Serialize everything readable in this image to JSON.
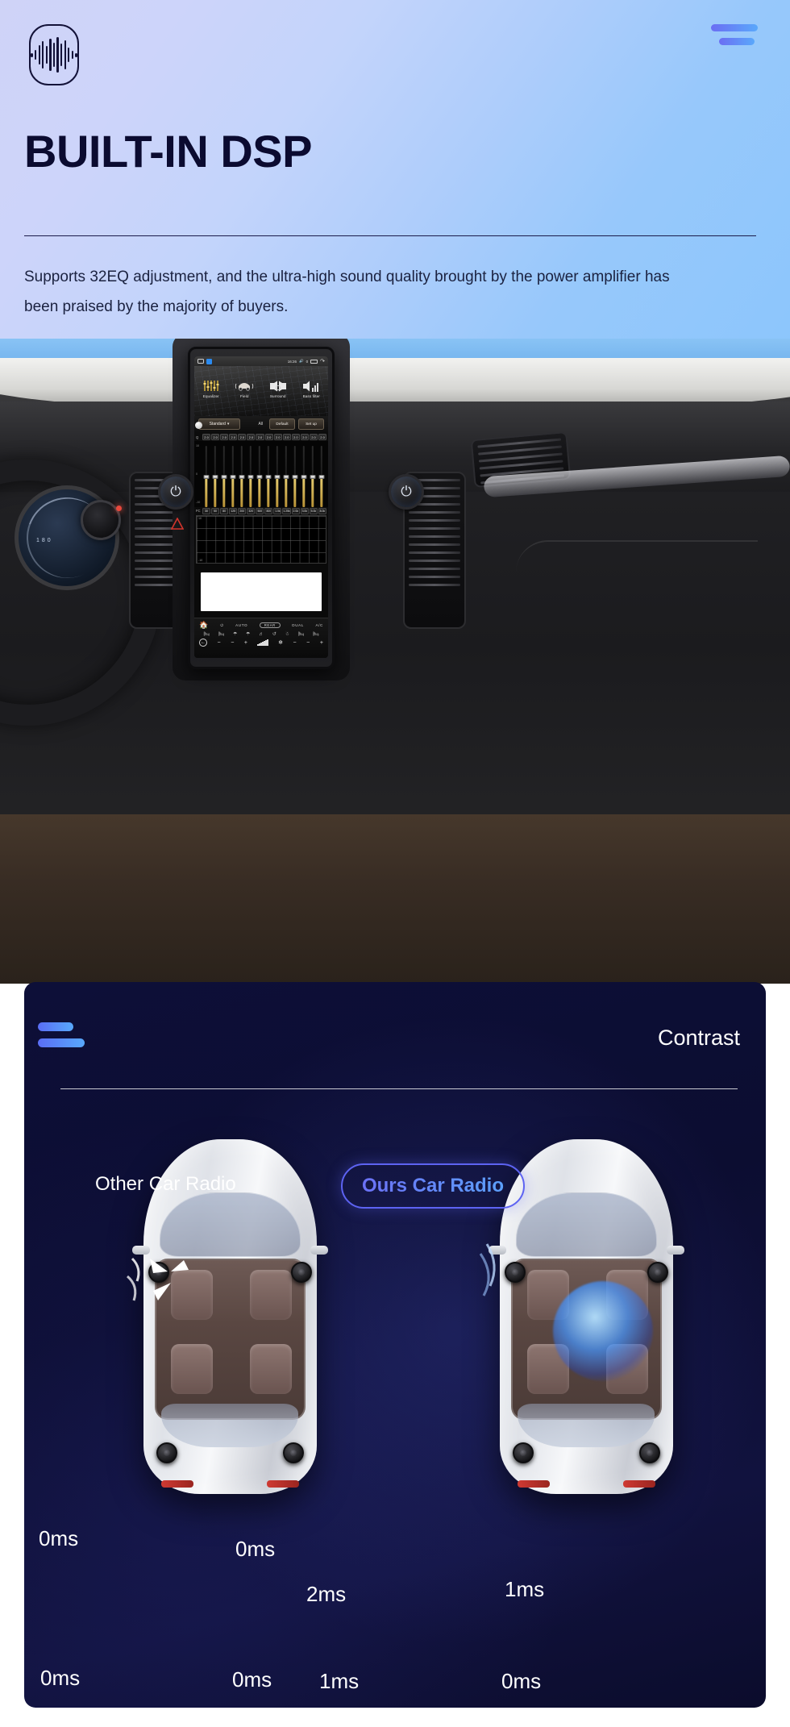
{
  "hero": {
    "icon_name": "audio-waveform-icon",
    "menu_icon": "hamburger-menu-icon",
    "title": "BUILT-IN DSP",
    "subtitle": "Supports 32EQ adjustment, and the ultra-high sound quality brought by the power amplifier has been praised by the majority of buyers.",
    "gradient_from": "#cfd3f7",
    "gradient_to": "#8cc6fc",
    "title_color": "#0b0b30",
    "accent_from": "#6b6ef3",
    "accent_to": "#5aa8fb"
  },
  "head_unit": {
    "status": {
      "time": "16:26",
      "volume_icon": "volume-icon",
      "battery_icon": "battery-icon",
      "back_icon": "back-arrow-icon",
      "car_icon": "car-icon",
      "app_icon": "app-icon",
      "signal": "0"
    },
    "tabs": [
      {
        "label": "Equalizer",
        "icon": "equalizer-sliders-icon",
        "active": true
      },
      {
        "label": "Field",
        "icon": "sound-field-car-icon",
        "active": false
      },
      {
        "label": "Surround",
        "icon": "surround-sound-icon",
        "active": false
      },
      {
        "label": "Bass filter",
        "icon": "bass-filter-icon",
        "active": false
      }
    ],
    "controls": {
      "preset": "Standard",
      "preset_caret": "⌄",
      "all_label": "All",
      "default_label": "Default",
      "setup_label": "Set up"
    },
    "eq": {
      "q_label": "Q",
      "fc_label": "FC",
      "axis_top": "10",
      "axis_zero": "0",
      "axis_bottom": "-10",
      "graph_axis_top": "10",
      "graph_axis_bottom": "-10",
      "q_values": [
        "2.0",
        "2.0",
        "2.0",
        "2.0",
        "2.0",
        "2.0",
        "2.0",
        "2.0",
        "2.0",
        "2.0",
        "2.0",
        "2.0",
        "2.0",
        "2.0"
      ],
      "frequencies": [
        "30",
        "50",
        "80",
        "125",
        "200",
        "320",
        "500",
        "800",
        "1.0k",
        "1.25k",
        "2.0k",
        "3.0k",
        "5.0k",
        "8.0k"
      ],
      "gains": [
        0,
        0,
        0,
        0,
        0,
        0,
        0,
        0,
        0,
        0,
        0,
        0,
        0,
        0
      ],
      "bar_color": "#cdb055"
    },
    "climate": {
      "home_icon": "home-icon",
      "power_icon": "power-icon",
      "auto_label": "AUTO",
      "rear_label": "REAR",
      "dual_label": "DUAL",
      "ac_label": "A/C",
      "back_icon": "back-arrow-circle-icon",
      "minus_left": "−",
      "minus_left2": "−",
      "plus_left": "+",
      "fan_icon": "fan-icon",
      "minus_right": "−",
      "minus_right2": "−",
      "plus_right": "+",
      "seat_heat_icons": [
        "seat-heat-left-icon",
        "seat-heat-right-icon",
        "defrost-front-icon",
        "defrost-rear-icon",
        "airflow-face-icon",
        "airflow-feet-icon",
        "recirculate-icon",
        "seat-vent-left-icon",
        "seat-vent-right-icon"
      ]
    }
  },
  "contrast": {
    "menu_icon": "hamburger-menu-icon",
    "title": "Contrast",
    "background": "#0d0f38",
    "left_car": {
      "name": "other-car-radio",
      "label": "Other Car Radio",
      "delays": [
        {
          "position": "front-left",
          "value": "0ms"
        },
        {
          "position": "front-right",
          "value": "0ms"
        },
        {
          "position": "rear-left",
          "value": "0ms"
        },
        {
          "position": "rear-right",
          "value": "0ms"
        }
      ]
    },
    "right_car": {
      "name": "ours-car-radio",
      "label": "Ours Car Radio",
      "delays": [
        {
          "position": "front-left",
          "value": "2ms"
        },
        {
          "position": "front-right",
          "value": "1ms"
        },
        {
          "position": "rear-left",
          "value": "1ms"
        },
        {
          "position": "rear-right",
          "value": "0ms"
        }
      ],
      "button_border": "#5d63f2",
      "button_text_from": "#6d6bf6",
      "button_text_to": "#5aa6fb"
    }
  }
}
